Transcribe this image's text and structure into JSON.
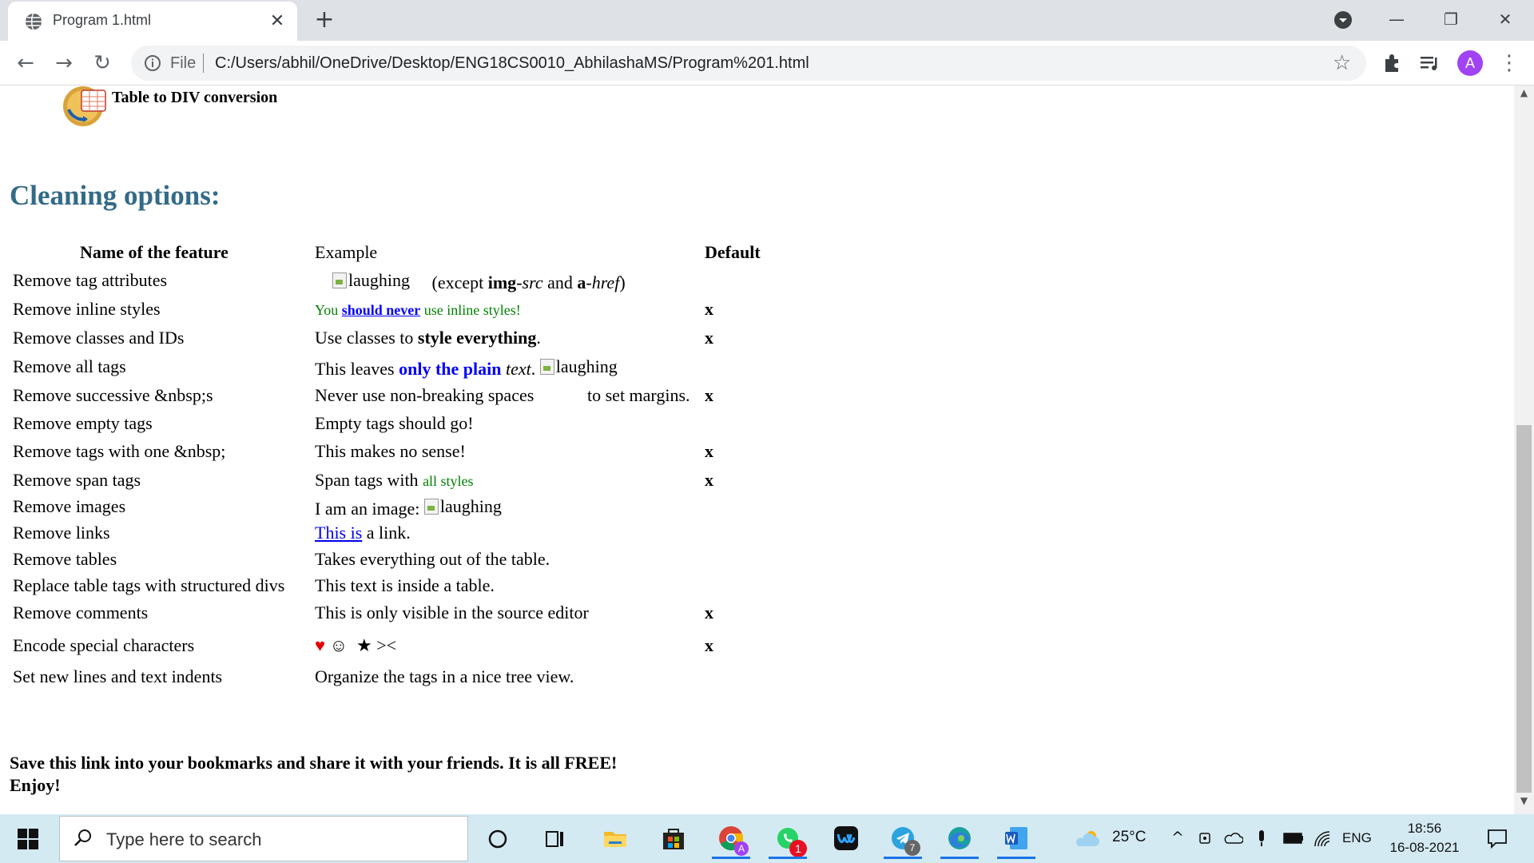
{
  "browser": {
    "tab_title": "Program 1.html",
    "tab_close": "✕",
    "new_tab": "+",
    "address_scheme": "File",
    "address_url": "C:/Users/abhil/OneDrive/Desktop/ENG18CS0010_AbhilashaMS/Program%201.html",
    "profile_initial": "A",
    "minimize": "—",
    "restore": "❐",
    "close": "✕",
    "back": "←",
    "forward": "→",
    "reload": "↻",
    "star": "☆",
    "menu": "⋮"
  },
  "page": {
    "logo_text": "Table to DIV conversion",
    "section_title": "Cleaning options:",
    "headers": {
      "feature": "Name of the feature",
      "example": "Example",
      "default": "Default"
    },
    "rows": {
      "r1": {
        "feature": "Remove tag attributes",
        "img_alt": "laughing",
        "ex_a": "(except ",
        "ex_b": "img",
        "ex_c": "-",
        "ex_d": "src",
        "ex_e": " and ",
        "ex_f": "a",
        "ex_g": "-",
        "ex_h": "href",
        "ex_i": ")",
        "default": ""
      },
      "r2": {
        "feature": "Remove inline styles",
        "ex_a": "You ",
        "ex_b": "should never",
        "ex_c": " use inline styles!",
        "default": "x"
      },
      "r3": {
        "feature": "Remove classes and IDs",
        "ex_a": "Use classes to ",
        "ex_b": "style everything",
        "ex_c": ".",
        "default": "x"
      },
      "r4": {
        "feature": "Remove all tags",
        "ex_a": "This leaves ",
        "ex_b": "only the plain",
        "ex_c": " ",
        "ex_d": "text",
        "ex_e": ". ",
        "img_alt": "laughing",
        "default": ""
      },
      "r5": {
        "feature": "Remove successive &nbsp;s",
        "ex_a": "Never use non-breaking spaces",
        "ex_b": "to set margins.",
        "default": "x"
      },
      "r6": {
        "feature": "Remove empty tags",
        "example": "Empty tags should go!",
        "default": ""
      },
      "r7": {
        "feature": "Remove tags with one &nbsp;",
        "example": "This makes no sense!",
        "default": "x"
      },
      "r8": {
        "feature": "Remove span tags",
        "ex_a": "Span tags with ",
        "ex_b": "all styles",
        "default": "x"
      },
      "r9": {
        "feature": "Remove images",
        "ex_a": "I am an image: ",
        "img_alt": "laughing",
        "default": ""
      },
      "r10": {
        "feature": "Remove links",
        "link": "This is",
        "ex_b": " a link.",
        "default": ""
      },
      "r11": {
        "feature": "Remove tables",
        "example": "Takes everything out of the table.",
        "default": ""
      },
      "r12": {
        "feature": "Replace table tags with structured divs",
        "example": "This text is inside a table.",
        "default": ""
      },
      "r13": {
        "feature": "Remove comments",
        "example": "This is only visible in the source editor",
        "default": "x"
      },
      "r14": {
        "feature": "Encode special characters",
        "heart": "♥",
        "smile": "☺",
        "star": "★",
        "rest": "><",
        "default": "x"
      },
      "r15": {
        "feature": "Set new lines and text indents",
        "example": "Organize the tags in a nice tree view.",
        "default": ""
      }
    },
    "footer_line1": "Save this link into your bookmarks and share it with your friends. It is all FREE!",
    "footer_line2": "Enjoy!"
  },
  "taskbar": {
    "search_placeholder": "Type here to search",
    "weather": "25°C",
    "language": "ENG",
    "time": "18:56",
    "date": "16-08-2021",
    "whatsapp_badge": "1",
    "telegram_badge": "7",
    "chrome_badge": "A"
  }
}
